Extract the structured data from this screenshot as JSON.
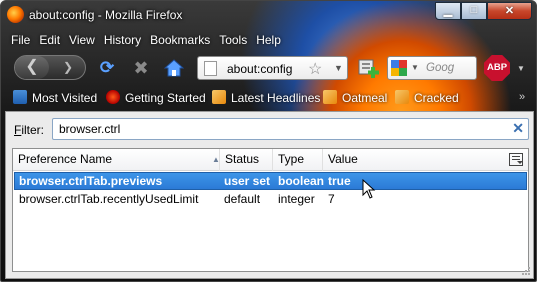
{
  "window": {
    "title": "about:config - Mozilla Firefox",
    "controls": {
      "minimize": "▁",
      "maximize": "□",
      "close": "✕"
    }
  },
  "menu": [
    "File",
    "Edit",
    "View",
    "History",
    "Bookmarks",
    "Tools",
    "Help"
  ],
  "navbar": {
    "url": "about:config",
    "search_placeholder": "Goog",
    "adblock_label": "ABP"
  },
  "bookmarks": [
    "Most Visited",
    "Getting Started",
    "Latest Headlines",
    "Oatmeal",
    "Cracked"
  ],
  "filter": {
    "label_hotkey": "F",
    "label_rest": "ilter:",
    "value": "browser.ctrl"
  },
  "table": {
    "columns": [
      "Preference Name",
      "Status",
      "Type",
      "Value"
    ],
    "rows": [
      {
        "name": "browser.ctrlTab.previews",
        "status": "user set",
        "type": "boolean",
        "value": "true",
        "selected": true
      },
      {
        "name": "browser.ctrlTab.recentlyUsedLimit",
        "status": "default",
        "type": "integer",
        "value": "7",
        "selected": false
      }
    ]
  },
  "colors": {
    "selection": "#2b7ad6",
    "chrome_dark": "#161616",
    "firefox_orange": "#ff7a00",
    "adblock_red": "#c8102e"
  }
}
